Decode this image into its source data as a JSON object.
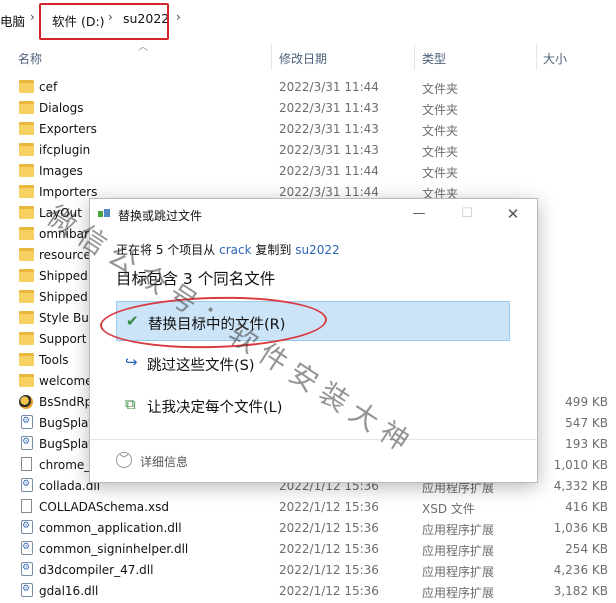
{
  "breadcrumb": {
    "items": [
      "电脑",
      "软件 (D:)",
      "su2022"
    ],
    "separator": "›"
  },
  "columns": {
    "name": "名称",
    "modified": "修改日期",
    "type": "类型",
    "size": "大小"
  },
  "files": [
    {
      "name": "cef",
      "date": "2022/3/31 11:44",
      "type": "文件夹",
      "size": "",
      "icon": "folder"
    },
    {
      "name": "Dialogs",
      "date": "2022/3/31 11:43",
      "type": "文件夹",
      "size": "",
      "icon": "folder"
    },
    {
      "name": "Exporters",
      "date": "2022/3/31 11:43",
      "type": "文件夹",
      "size": "",
      "icon": "folder"
    },
    {
      "name": "ifcplugin",
      "date": "2022/3/31 11:43",
      "type": "文件夹",
      "size": "",
      "icon": "folder"
    },
    {
      "name": "Images",
      "date": "2022/3/31 11:44",
      "type": "文件夹",
      "size": "",
      "icon": "folder"
    },
    {
      "name": "Importers",
      "date": "2022/3/31 11:44",
      "type": "文件夹",
      "size": "",
      "icon": "folder"
    },
    {
      "name": "LayOut",
      "date": "",
      "type": "",
      "size": "",
      "icon": "folder"
    },
    {
      "name": "omnibar",
      "date": "",
      "type": "",
      "size": "",
      "icon": "folder"
    },
    {
      "name": "resources",
      "date": "",
      "type": "",
      "size": "",
      "icon": "folder"
    },
    {
      "name": "Shipped",
      "date": "",
      "type": "",
      "size": "",
      "icon": "folder"
    },
    {
      "name": "Shipped",
      "date": "",
      "type": "",
      "size": "",
      "icon": "folder"
    },
    {
      "name": "Style Bui",
      "date": "",
      "type": "",
      "size": "",
      "icon": "folder"
    },
    {
      "name": "Support",
      "date": "",
      "type": "",
      "size": "",
      "icon": "folder"
    },
    {
      "name": "Tools",
      "date": "",
      "type": "",
      "size": "",
      "icon": "folder"
    },
    {
      "name": "welcome",
      "date": "",
      "type": "",
      "size": "",
      "icon": "folder"
    },
    {
      "name": "BsSndRp",
      "date": "",
      "type": "",
      "size": "499 KB",
      "icon": "bug"
    },
    {
      "name": "BugSplat",
      "date": "",
      "type": "",
      "size": "547 KB",
      "icon": "gear"
    },
    {
      "name": "BugSplat",
      "date": "",
      "type": "",
      "size": "193 KB",
      "icon": "gear"
    },
    {
      "name": "chrome_",
      "date": "",
      "type": "",
      "size": "1,010 KB",
      "icon": "file"
    },
    {
      "name": "collada.dll",
      "date": "2022/1/12 15:36",
      "type": "应用程序扩展",
      "size": "4,332 KB",
      "icon": "gear"
    },
    {
      "name": "COLLADASchema.xsd",
      "date": "2022/1/12 15:36",
      "type": "XSD 文件",
      "size": "416 KB",
      "icon": "file"
    },
    {
      "name": "common_application.dll",
      "date": "2022/1/12 15:36",
      "type": "应用程序扩展",
      "size": "1,036 KB",
      "icon": "gear"
    },
    {
      "name": "common_signinhelper.dll",
      "date": "2022/1/12 15:36",
      "type": "应用程序扩展",
      "size": "254 KB",
      "icon": "gear"
    },
    {
      "name": "d3dcompiler_47.dll",
      "date": "2022/1/12 15:36",
      "type": "应用程序扩展",
      "size": "4,236 KB",
      "icon": "gear"
    },
    {
      "name": "gdal16.dll",
      "date": "2022/1/12 15:36",
      "type": "应用程序扩展",
      "size": "3,182 KB",
      "icon": "gear"
    }
  ],
  "dialog": {
    "title": "替换或跳过文件",
    "sub_prefix": "正在将 5 个项目从",
    "source": "crack",
    "sub_mid": "复制到",
    "dest": "su2022",
    "heading": "目标包含 3 个同名文件",
    "options": [
      {
        "label": "替换目标中的文件(R)",
        "icon": "checkmark-icon",
        "selected": true
      },
      {
        "label": "跳过这些文件(S)",
        "icon": "skip-arrow-icon",
        "selected": false
      },
      {
        "label": "让我决定每个文件(L)",
        "icon": "decide-files-icon",
        "selected": false
      }
    ],
    "details": "详细信息"
  },
  "watermark": "微信公众号：软件安装大神",
  "colors": {
    "highlight": "#d5232c",
    "selected_bg": "#cce4f7",
    "link": "#2a66b8",
    "folder": "#f6d162"
  }
}
